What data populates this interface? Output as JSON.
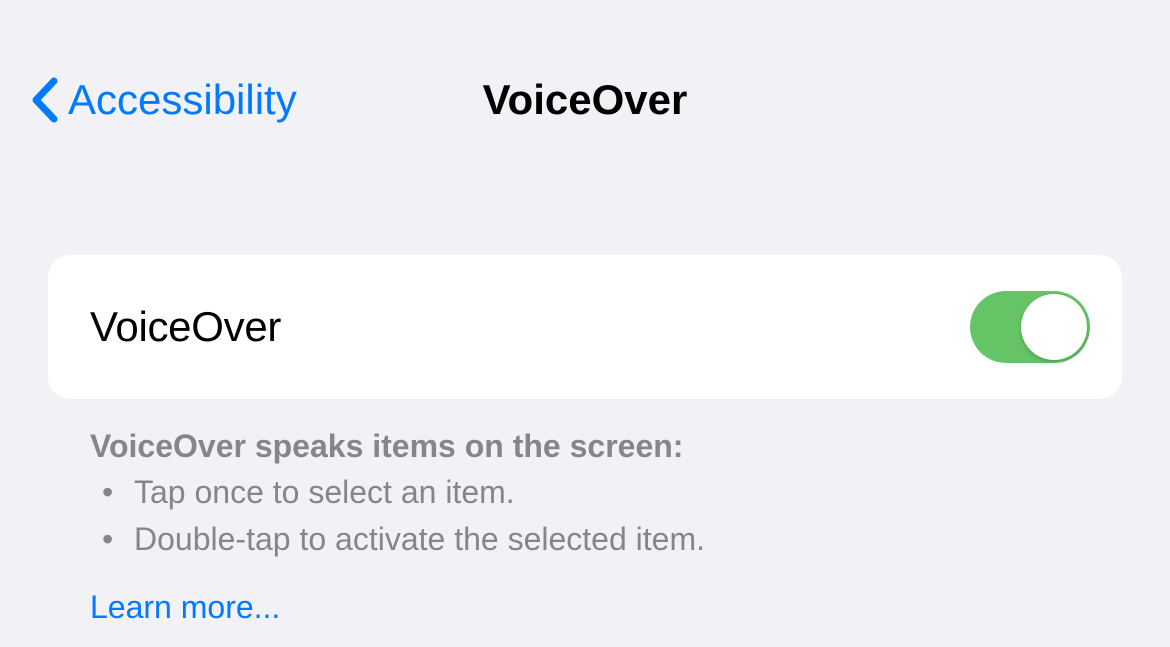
{
  "navbar": {
    "back_label": "Accessibility",
    "title": "VoiceOver"
  },
  "card": {
    "label": "VoiceOver",
    "toggle_on": true
  },
  "description": {
    "heading": "VoiceOver speaks items on the screen:",
    "bullets": [
      "Tap once to select an item.",
      "Double-tap to activate the selected item."
    ],
    "learn_more": "Learn more..."
  }
}
